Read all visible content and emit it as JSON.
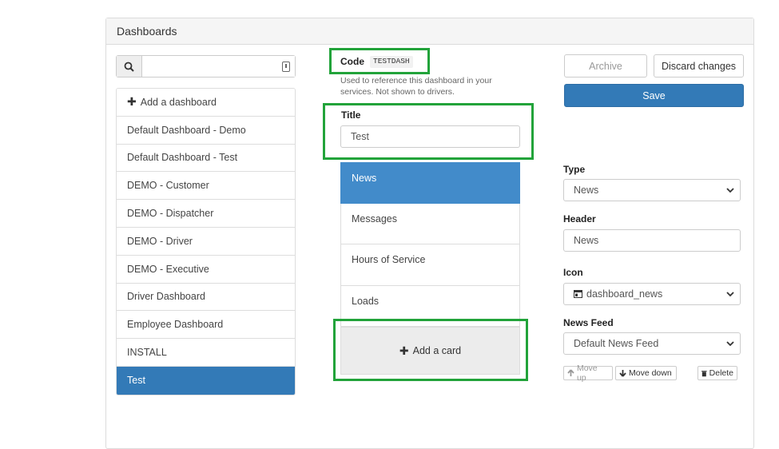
{
  "panel": {
    "title": "Dashboards"
  },
  "search": {
    "value": "",
    "placeholder": ""
  },
  "sidebar": {
    "add_label": "Add a dashboard",
    "items": [
      {
        "label": "Default Dashboard - Demo"
      },
      {
        "label": "Default Dashboard - Test"
      },
      {
        "label": "DEMO - Customer"
      },
      {
        "label": "DEMO - Dispatcher"
      },
      {
        "label": "DEMO - Driver"
      },
      {
        "label": "DEMO - Executive"
      },
      {
        "label": "Driver Dashboard"
      },
      {
        "label": "Employee Dashboard"
      },
      {
        "label": "INSTALL"
      },
      {
        "label": "Test",
        "active": true
      }
    ]
  },
  "editor": {
    "code_label": "Code",
    "code_value": "TESTDASH",
    "code_help": "Used to reference this dashboard in your services. Not shown to drivers.",
    "title_label": "Title",
    "title_value": "Test",
    "cards": [
      {
        "label": "News",
        "active": true
      },
      {
        "label": "Messages"
      },
      {
        "label": "Hours of Service"
      },
      {
        "label": "Loads"
      }
    ],
    "add_card_label": "Add a card"
  },
  "actions": {
    "archive_label": "Archive",
    "discard_label": "Discard changes",
    "save_label": "Save"
  },
  "card_settings": {
    "type_label": "Type",
    "type_value": "News",
    "header_label": "Header",
    "header_value": "News",
    "icon_label": "Icon",
    "icon_value": "dashboard_news",
    "feed_label": "News Feed",
    "feed_value": "Default News Feed",
    "move_up_label": "Move up",
    "move_down_label": "Move down",
    "delete_label": "Delete"
  },
  "colors": {
    "highlight": "#22a33a",
    "accent": "#337ab7"
  }
}
